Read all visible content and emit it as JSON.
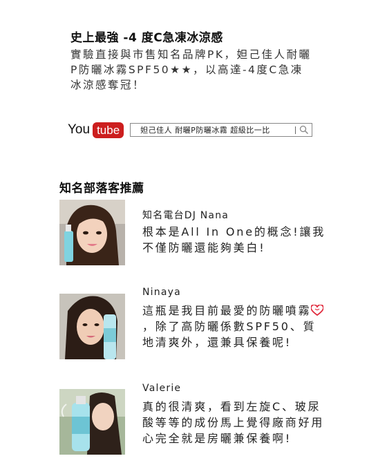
{
  "headline": "史上最強 -4 度C急凍冰涼感",
  "intro": "實驗直接與市售知名品牌PK，妲己佳人耐曬P防曬冰霧SPF50★★，以高達-4度C急凍冰涼感奪冠！",
  "youtube": {
    "you_label": "You",
    "tube_label": "tube",
    "search_query": "妲己佳人 耐曬P防曬冰霧 超級比一比",
    "colors": {
      "tube_bg": "#cc1e1e"
    }
  },
  "section_title": "知名部落客推薦",
  "testimonials": [
    {
      "name": "知名電台DJ Nana",
      "quote": "根本是All In One的概念!讓我不僅防曬還能夠美白!"
    },
    {
      "name": "Ninaya",
      "quote_before": "這瓶是我目前最愛的防曬噴霧",
      "quote_icon": "heart-icon",
      "quote_after": "，除了高防曬係數SPF50、質地清爽外，還兼具保養呢!"
    },
    {
      "name": "Valerie",
      "quote": "真的很清爽，看到左旋C、玻尿酸等等的成份馬上覺得廠商好用心完全就是房曬兼保養啊!"
    }
  ]
}
